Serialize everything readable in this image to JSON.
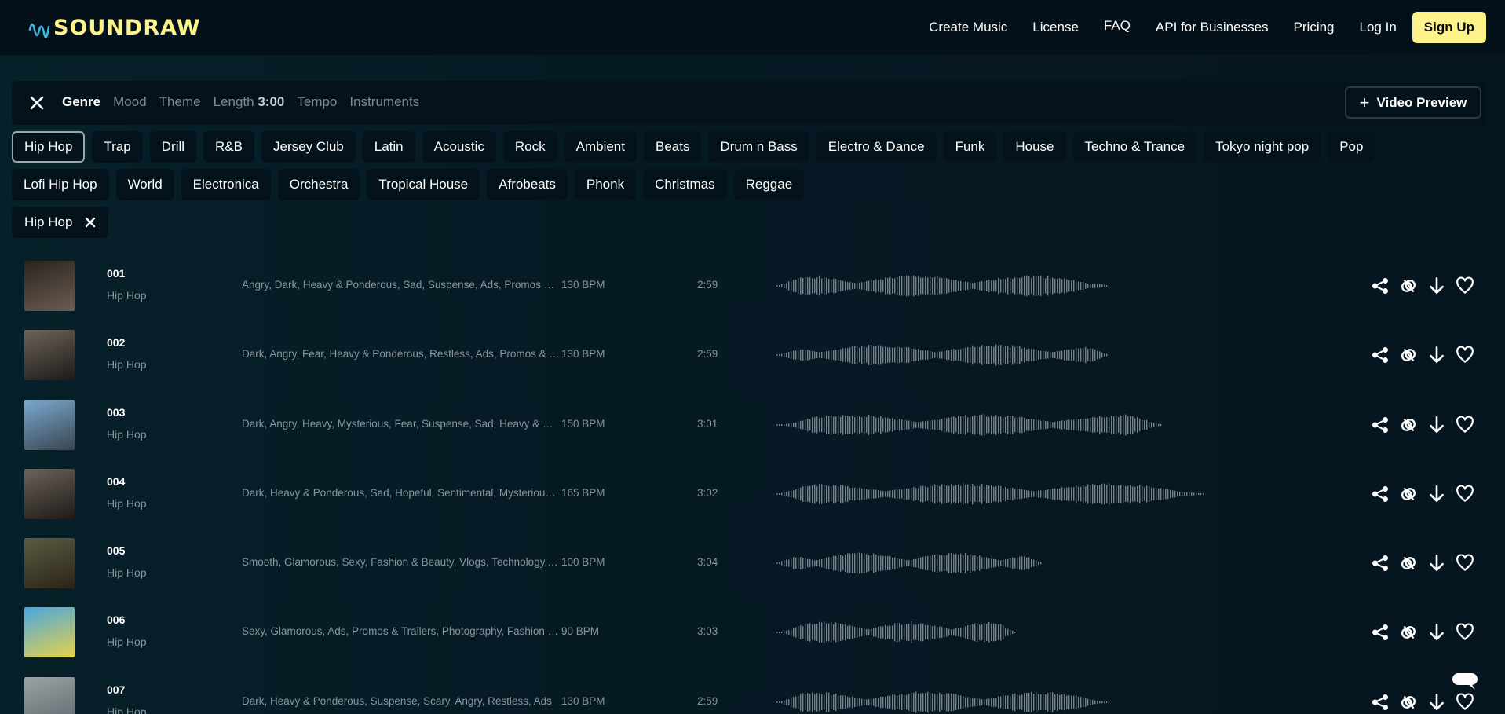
{
  "brand": {
    "name": "SOUNDRAW",
    "accent": "#fdf38a"
  },
  "nav": {
    "links": [
      "Create Music",
      "License",
      "FAQ",
      "API for Businesses",
      "Pricing",
      "Log In"
    ],
    "signup": "Sign Up"
  },
  "filter": {
    "close_icon": "close-icon",
    "tabs": [
      "Genre",
      "Mood",
      "Theme"
    ],
    "length_label": "Length",
    "length_value": "3:00",
    "tabs_after": [
      "Tempo",
      "Instruments"
    ],
    "active_tab": "Genre",
    "video_preview": "Video Preview"
  },
  "genres": {
    "row1": [
      "Hip Hop",
      "Trap",
      "Drill",
      "R&B",
      "Jersey Club",
      "Latin",
      "Acoustic",
      "Rock",
      "Ambient",
      "Beats",
      "Drum n Bass",
      "Electro & Dance",
      "Funk",
      "House",
      "Techno & Trance",
      "Tokyo night pop",
      "Pop"
    ],
    "row2": [
      "Lofi Hip Hop",
      "World",
      "Electronica",
      "Orchestra",
      "Tropical House",
      "Afrobeats",
      "Phonk",
      "Christmas",
      "Reggae"
    ],
    "selected": "Hip Hop"
  },
  "selected_filter": {
    "label": "Hip Hop"
  },
  "tracks": [
    {
      "num": "001",
      "genre": "Hip Hop",
      "tags": "Angry, Dark, Heavy & Ponderous, Sad, Suspense, Ads, Promos & Trailers, Fashion",
      "bpm": "130 BPM",
      "duration": "2:59",
      "thumb_colors": [
        "#2a241f",
        "#6b5d52"
      ]
    },
    {
      "num": "002",
      "genre": "Hip Hop",
      "tags": "Dark, Angry, Fear, Heavy & Ponderous, Restless, Ads, Promos & Trailers",
      "bpm": "130 BPM",
      "duration": "2:59",
      "thumb_colors": [
        "#6d6359",
        "#1d1a18"
      ]
    },
    {
      "num": "003",
      "genre": "Hip Hop",
      "tags": "Dark, Angry, Heavy, Mysterious, Fear, Suspense, Sad, Heavy & Ponderous",
      "bpm": "150 BPM",
      "duration": "3:01",
      "thumb_colors": [
        "#7aa9cf",
        "#3a4550"
      ]
    },
    {
      "num": "004",
      "genre": "Hip Hop",
      "tags": "Dark, Heavy & Ponderous, Sad, Hopeful, Sentimental, Mysterious, Ads",
      "bpm": "165 BPM",
      "duration": "3:02",
      "thumb_colors": [
        "#6d6359",
        "#1d1a18"
      ]
    },
    {
      "num": "005",
      "genre": "Hip Hop",
      "tags": "Smooth, Glamorous, Sexy, Fashion & Beauty, Vlogs, Technology, Ads",
      "bpm": "100 BPM",
      "duration": "3:04",
      "thumb_colors": [
        "#5b5a42",
        "#2b2418"
      ]
    },
    {
      "num": "006",
      "genre": "Hip Hop",
      "tags": "Sexy, Glamorous, Ads, Promos & Trailers, Photography, Fashion & Beauty",
      "bpm": "90 BPM",
      "duration": "3:03",
      "thumb_colors": [
        "#4aa6e0",
        "#e7d24a"
      ]
    },
    {
      "num": "007",
      "genre": "Hip Hop",
      "tags": "Dark, Heavy & Ponderous, Suspense, Scary, Angry, Restless, Ads",
      "bpm": "130 BPM",
      "duration": "2:59",
      "thumb_colors": [
        "#9aa3a6",
        "#5d676b"
      ]
    }
  ],
  "track_actions": [
    "share-icon",
    "link-icon",
    "download-icon",
    "heart-icon"
  ],
  "wave_colors": {
    "bar": "#75828a"
  }
}
